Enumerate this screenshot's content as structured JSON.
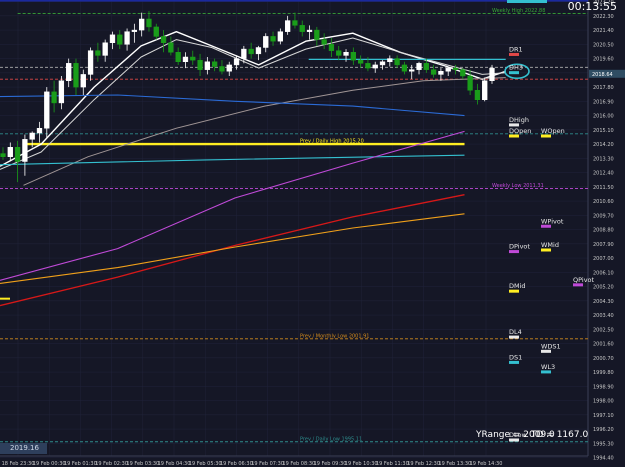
{
  "window": {
    "timer": "00:13:55",
    "yrange_text": "YRange = 2009.0",
    "td_text": "TD = 1167.0",
    "date_box": "2019.16"
  },
  "colors": {
    "background": "#151726",
    "grid": "#20243a",
    "axis_text": "#c8c8c8",
    "candle_up": "#ffffff",
    "candle_down": "#1a9d1a",
    "ema_fast": "#ffffff",
    "ema_slow": "#d7d7d7",
    "sma_long": "#a09595",
    "blue_line": "#2b6bd6",
    "cyan_line": "#34c0d0",
    "magenta_line": "#c04ad8",
    "red_line": "#d61818",
    "orange_line": "#f0a01a",
    "yellow_line": "#ffee22",
    "navy_line": "#1b2cb0"
  },
  "chart_data": {
    "type": "line",
    "ylim": [
      1994.5,
      2023.3
    ],
    "y_ticks": [
      "2023.20",
      "2022.30",
      "2021.40",
      "2020.50",
      "2019.60",
      "2018.70",
      "2017.80",
      "2016.90",
      "2016.00",
      "2015.10",
      "2014.20",
      "2013.30",
      "2012.40",
      "2011.50",
      "2010.60",
      "2009.70",
      "2008.80",
      "2007.90",
      "2007.00",
      "2006.10",
      "2005.20",
      "2004.30",
      "2003.40",
      "2002.50",
      "2001.60",
      "2000.70",
      "1999.80",
      "1998.90",
      "1998.00",
      "1997.10",
      "1996.20",
      "1995.30",
      "1994.40"
    ],
    "current_price": "2018.64",
    "x_ticks": [
      "18 Feb 23:30",
      "19 Feb 00:30",
      "19 Feb 01:30",
      "19 Feb 02:30",
      "19 Feb 03:30",
      "19 Feb 04:30",
      "19 Feb 05:30",
      "19 Feb 06:30",
      "19 Feb 07:30",
      "19 Feb 08:30",
      "19 Feb 09:30",
      "19 Feb 10:30",
      "19 Feb 11:30",
      "19 Feb 12:30",
      "19 Feb 13:30",
      "19 Feb 14:30"
    ],
    "candles": [
      [
        2013.6,
        2014.0,
        2013.2,
        2013.4
      ],
      [
        2013.4,
        2014.3,
        2013.1,
        2014.0
      ],
      [
        2014.0,
        2014.4,
        2011.8,
        2013.1
      ],
      [
        2013.1,
        2014.8,
        2012.2,
        2014.5
      ],
      [
        2014.5,
        2015.0,
        2014.0,
        2014.9
      ],
      [
        2014.9,
        2015.6,
        2014.3,
        2015.2
      ],
      [
        2015.2,
        2017.8,
        2014.6,
        2017.5
      ],
      [
        2017.5,
        2018.2,
        2016.2,
        2016.8
      ],
      [
        2016.8,
        2018.5,
        2016.4,
        2018.2
      ],
      [
        2018.2,
        2019.6,
        2017.8,
        2019.3
      ],
      [
        2019.3,
        2019.6,
        2017.3,
        2017.8
      ],
      [
        2017.8,
        2018.9,
        2017.3,
        2018.6
      ],
      [
        2018.6,
        2020.3,
        2018.2,
        2020.1
      ],
      [
        2020.1,
        2020.6,
        2019.4,
        2019.8
      ],
      [
        2019.8,
        2020.8,
        2019.4,
        2020.6
      ],
      [
        2020.6,
        2021.3,
        2020.2,
        2021.1
      ],
      [
        2021.1,
        2021.4,
        2020.2,
        2020.5
      ],
      [
        2020.5,
        2021.5,
        2020.1,
        2021.3
      ],
      [
        2021.3,
        2021.8,
        2020.6,
        2021.4
      ],
      [
        2021.4,
        2022.5,
        2021.0,
        2022.1
      ],
      [
        2022.1,
        2022.6,
        2021.3,
        2021.6
      ],
      [
        2021.6,
        2021.8,
        2020.8,
        2021.0
      ],
      [
        2021.0,
        2021.4,
        2020.0,
        2020.6
      ],
      [
        2020.6,
        2021.0,
        2019.8,
        2020.0
      ],
      [
        2020.0,
        2020.3,
        2019.2,
        2019.4
      ],
      [
        2019.4,
        2020.0,
        2019.0,
        2019.7
      ],
      [
        2019.7,
        2020.1,
        2019.2,
        2019.5
      ],
      [
        2019.5,
        2019.9,
        2018.5,
        2018.9
      ],
      [
        2018.9,
        2019.7,
        2018.6,
        2019.4
      ],
      [
        2019.4,
        2019.6,
        2018.8,
        2019.1
      ],
      [
        2019.1,
        2019.5,
        2018.6,
        2018.8
      ],
      [
        2018.8,
        2019.4,
        2018.5,
        2019.2
      ],
      [
        2019.2,
        2019.8,
        2018.9,
        2019.6
      ],
      [
        2019.6,
        2020.4,
        2019.3,
        2020.2
      ],
      [
        2020.2,
        2020.6,
        2019.6,
        2019.9
      ],
      [
        2019.9,
        2020.4,
        2019.5,
        2020.3
      ],
      [
        2020.3,
        2021.2,
        2020.0,
        2021.0
      ],
      [
        2021.0,
        2021.3,
        2020.4,
        2020.7
      ],
      [
        2020.7,
        2021.5,
        2020.5,
        2021.3
      ],
      [
        2021.3,
        2022.3,
        2021.1,
        2022.0
      ],
      [
        2022.0,
        2022.5,
        2021.5,
        2021.7
      ],
      [
        2021.7,
        2022.0,
        2021.0,
        2021.3
      ],
      [
        2021.3,
        2021.7,
        2020.8,
        2021.4
      ],
      [
        2021.4,
        2021.6,
        2020.4,
        2020.8
      ],
      [
        2020.8,
        2021.2,
        2020.2,
        2020.5
      ],
      [
        2020.5,
        2020.9,
        2019.7,
        2020.1
      ],
      [
        2020.1,
        2020.4,
        2019.5,
        2019.8
      ],
      [
        2019.8,
        2020.2,
        2019.4,
        2020.0
      ],
      [
        2020.0,
        2020.3,
        2019.2,
        2019.5
      ],
      [
        2019.5,
        2019.8,
        2019.0,
        2019.3
      ],
      [
        2019.3,
        2019.7,
        2018.8,
        2019.0
      ],
      [
        2019.0,
        2019.4,
        2018.7,
        2019.2
      ],
      [
        2019.2,
        2019.5,
        2018.9,
        2019.4
      ],
      [
        2019.4,
        2019.8,
        2019.1,
        2019.6
      ],
      [
        2019.6,
        2019.8,
        2019.0,
        2019.2
      ],
      [
        2019.2,
        2019.4,
        2018.6,
        2018.8
      ],
      [
        2018.8,
        2019.2,
        2018.3,
        2018.9
      ],
      [
        2018.9,
        2019.4,
        2018.6,
        2019.3
      ],
      [
        2019.3,
        2019.6,
        2018.7,
        2018.9
      ],
      [
        2018.9,
        2019.2,
        2018.4,
        2018.6
      ],
      [
        2018.6,
        2019.0,
        2018.2,
        2018.8
      ],
      [
        2018.8,
        2019.1,
        2018.5,
        2019.0
      ],
      [
        2019.0,
        2019.2,
        2018.6,
        2018.9
      ],
      [
        2018.9,
        2019.0,
        2018.3,
        2018.5
      ],
      [
        2018.5,
        2018.9,
        2017.3,
        2017.6
      ],
      [
        2017.6,
        2018.0,
        2016.7,
        2017.0
      ],
      [
        2017.0,
        2018.4,
        2016.9,
        2018.2
      ],
      [
        2018.2,
        2019.2,
        2018.0,
        2019.0
      ]
    ],
    "hlines": [
      {
        "price": 2023.25,
        "color": "#1b2cb0",
        "style": "solid",
        "x_start": 0.0,
        "x_end": 1.0,
        "label": ""
      },
      {
        "price": 2022.45,
        "color": "#37a637",
        "style": "dash",
        "x_start": 0.03,
        "x_end": 1.0,
        "label": "Weekly High 2022.88"
      },
      {
        "price": 2019.05,
        "color": "#b0b0b0",
        "style": "dash",
        "x_start": 0.0,
        "x_end": 1.0,
        "label": ""
      },
      {
        "price": 2018.3,
        "color": "#e04848",
        "style": "dash",
        "x_start": 0.0,
        "x_end": 1.0,
        "label": ""
      },
      {
        "price": 2014.85,
        "color": "#2e8c8c",
        "style": "dash",
        "x_start": 0.0,
        "x_end": 1.0,
        "label": ""
      },
      {
        "price": 2014.2,
        "color": "#ffee22",
        "style": "solid",
        "x_start": 0.04,
        "x_end": 0.79,
        "label": "Prev / Daily High 2015.20"
      },
      {
        "price": 2011.4,
        "color": "#c04ad8",
        "style": "dash",
        "x_start": 0.0,
        "x_end": 1.0,
        "label": "Weekly Low 2011.31"
      },
      {
        "price": 2001.9,
        "color": "#d18a1c",
        "style": "dash",
        "x_start": 0.0,
        "x_end": 1.0,
        "label": "Prev / Monthly Low 2001.91"
      },
      {
        "price": 1995.4,
        "color": "#2e8c8c",
        "style": "dash",
        "x_start": 0.0,
        "x_end": 1.0,
        "label": "Prev / Daily Low 1995.11"
      }
    ],
    "series": [
      {
        "name": "EMA fast",
        "color": "#ffffff",
        "width": 1.4,
        "points": [
          [
            0,
            2012.8
          ],
          [
            0.07,
            2014.2
          ],
          [
            0.16,
            2017.8
          ],
          [
            0.24,
            2020.4
          ],
          [
            0.3,
            2021.3
          ],
          [
            0.36,
            2020.4
          ],
          [
            0.44,
            2019.2
          ],
          [
            0.52,
            2020.7
          ],
          [
            0.6,
            2021.2
          ],
          [
            0.68,
            2020.0
          ],
          [
            0.76,
            2019.1
          ],
          [
            0.82,
            2018.3
          ],
          [
            0.86,
            2018.8
          ]
        ]
      },
      {
        "name": "EMA slow",
        "color": "#d7d7d7",
        "width": 1.0,
        "points": [
          [
            0,
            2012.6
          ],
          [
            0.07,
            2013.7
          ],
          [
            0.16,
            2017.0
          ],
          [
            0.24,
            2019.7
          ],
          [
            0.3,
            2020.8
          ],
          [
            0.36,
            2020.3
          ],
          [
            0.44,
            2019.0
          ],
          [
            0.52,
            2020.2
          ],
          [
            0.6,
            2020.9
          ],
          [
            0.68,
            2020.0
          ],
          [
            0.76,
            2019.2
          ],
          [
            0.82,
            2018.6
          ],
          [
            0.86,
            2018.7
          ]
        ]
      },
      {
        "name": "SMA long",
        "color": "#a09595",
        "width": 1.0,
        "points": [
          [
            0.04,
            2011.6
          ],
          [
            0.15,
            2013.4
          ],
          [
            0.3,
            2015.2
          ],
          [
            0.45,
            2016.6
          ],
          [
            0.6,
            2017.6
          ],
          [
            0.72,
            2018.2
          ],
          [
            0.86,
            2018.4
          ]
        ]
      },
      {
        "name": "Blue",
        "color": "#2b6bd6",
        "width": 1.1,
        "points": [
          [
            0,
            2017.2
          ],
          [
            0.2,
            2017.3
          ],
          [
            0.4,
            2016.9
          ],
          [
            0.6,
            2016.6
          ],
          [
            0.79,
            2016.0
          ]
        ]
      },
      {
        "name": "Cyan flat",
        "color": "#34c0d0",
        "width": 1.3,
        "points": [
          [
            0.525,
            2019.55
          ],
          [
            0.86,
            2019.55
          ]
        ]
      },
      {
        "name": "Cyan low",
        "color": "#34c0d0",
        "width": 1.1,
        "points": [
          [
            0,
            2012.9
          ],
          [
            0.35,
            2013.2
          ],
          [
            0.79,
            2013.5
          ]
        ]
      },
      {
        "name": "Magenta",
        "color": "#c04ad8",
        "width": 1.1,
        "points": [
          [
            0,
            2005.6
          ],
          [
            0.2,
            2007.6
          ],
          [
            0.4,
            2010.8
          ],
          [
            0.6,
            2013.0
          ],
          [
            0.79,
            2015.0
          ]
        ]
      },
      {
        "name": "Red",
        "color": "#d61818",
        "width": 1.3,
        "points": [
          [
            0,
            2004.0
          ],
          [
            0.2,
            2005.8
          ],
          [
            0.4,
            2007.8
          ],
          [
            0.6,
            2009.6
          ],
          [
            0.79,
            2011.0
          ]
        ]
      },
      {
        "name": "Orange",
        "color": "#f0a01a",
        "width": 1.1,
        "points": [
          [
            0,
            2005.4
          ],
          [
            0.2,
            2006.4
          ],
          [
            0.4,
            2007.7
          ],
          [
            0.6,
            2008.9
          ],
          [
            0.79,
            2009.8
          ]
        ]
      }
    ],
    "level_markers": [
      {
        "text": "DR1",
        "price": 2020.05,
        "color": "#e04848",
        "column": 0
      },
      {
        "text": "DH3",
        "price": 2018.9,
        "color": "#34c0d0",
        "column": 0
      },
      {
        "text": "DHigh",
        "price": 2015.6,
        "color": "#e8e8e8",
        "column": 0
      },
      {
        "text": "DOpen",
        "price": 2014.9,
        "color": "#ffee22",
        "column": 0
      },
      {
        "text": "WOpen",
        "price": 2014.9,
        "color": "#ffee22",
        "column": 1
      },
      {
        "text": "WPivot",
        "price": 2009.2,
        "color": "#c04ad8",
        "column": 1
      },
      {
        "text": "DPivot",
        "price": 2007.6,
        "color": "#c04ad8",
        "column": 0
      },
      {
        "text": "WMid",
        "price": 2007.7,
        "color": "#ffee22",
        "column": 1
      },
      {
        "text": "QPivot",
        "price": 2005.5,
        "color": "#c04ad8",
        "column": 2
      },
      {
        "text": "DMid",
        "price": 2005.1,
        "color": "#ffee22",
        "column": 0
      },
      {
        "text": "DL4",
        "price": 2002.2,
        "color": "#e8e8e8",
        "column": 0
      },
      {
        "text": "WDS1",
        "price": 2001.3,
        "color": "#e8e8e8",
        "column": 1
      },
      {
        "text": "DS1",
        "price": 2000.6,
        "color": "#34c0d0",
        "column": 0
      },
      {
        "text": "WL3",
        "price": 2000.0,
        "color": "#34c0d0",
        "column": 1
      },
      {
        "text": "DLow",
        "price": 1995.7,
        "color": "#e8e8e8",
        "column": 0
      }
    ]
  }
}
